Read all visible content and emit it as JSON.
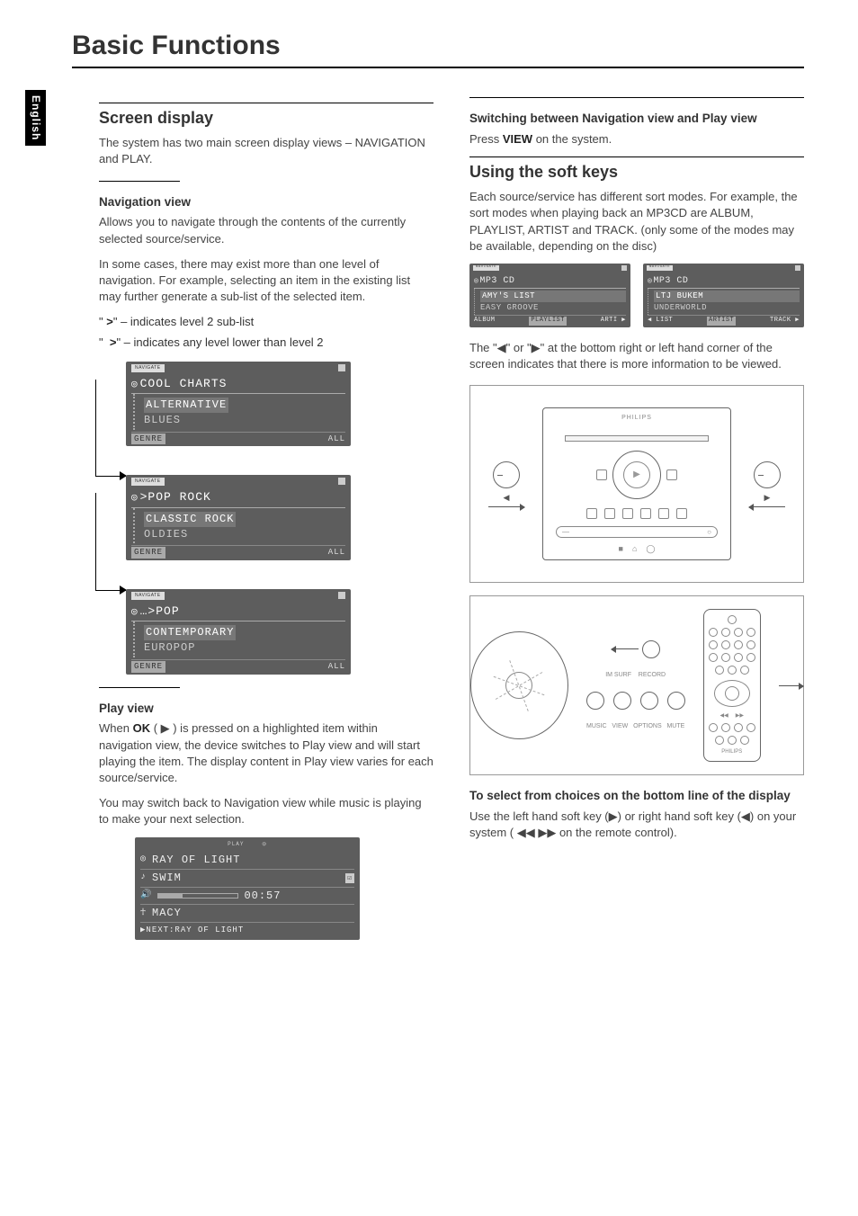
{
  "lang_tab": "English",
  "page_title": "Basic Functions",
  "left": {
    "h2": "Screen display",
    "intro": "The system has two main screen display views – NAVIGATION and PLAY.",
    "nav_view": {
      "heading": "Navigation view",
      "p1": "Allows you to navigate through the contents of the currently selected source/service.",
      "p2": "In some cases, there may exist more than one level of navigation. For example, selecting an item in the existing list may further generate a sub-list of the selected item.",
      "ind1_sym": ">",
      "ind1_txt": " – indicates level 2 sub-list",
      "ind2_sym": ">",
      "ind2_txt": " – indicates any level lower than level 2"
    },
    "lcd1": {
      "tab": "NAVIGATE",
      "title": "COOL CHARTS",
      "rows": [
        "ALTERNATIVE",
        "BLUES"
      ],
      "foot_l": "GENRE",
      "foot_r": "ALL"
    },
    "lcd2": {
      "tab": "NAVIGATE",
      "title": ">POP ROCK",
      "rows": [
        "CLASSIC ROCK",
        "OLDIES"
      ],
      "foot_l": "GENRE",
      "foot_r": "ALL"
    },
    "lcd3": {
      "tab": "NAVIGATE",
      "title": "…>POP",
      "rows": [
        "CONTEMPORARY",
        "EUROPOP"
      ],
      "foot_l": "GENRE",
      "foot_r": "ALL"
    },
    "play_view": {
      "heading": "Play view",
      "p1a": "When ",
      "p1b": "OK",
      "p1c": " ( ▶ ) is pressed on a highlighted item within navigation view, the device switches to Play view and will start playing the item.  The display content in Play view varies for each source/service.",
      "p2": "You may switch back to Navigation view while music is playing to make your next selection."
    },
    "lcd_play": {
      "top_l": "PLAY",
      "title": "RAY OF LIGHT",
      "row2": "SWIM",
      "time": "00:57",
      "row4": "MACY",
      "foot": "NEXT:RAY OF LIGHT"
    }
  },
  "right": {
    "switch": {
      "heading": "Switching between Navigation view and Play view",
      "p_a": "Press ",
      "p_b": "VIEW",
      "p_c": " on the system."
    },
    "soft": {
      "h2": "Using the soft keys",
      "p1": "Each source/service has different sort modes. For example, the sort modes when playing back an MP3CD are ALBUM, PLAYLIST, ARTIST and TRACK. (only some of the modes may be available, depending on the disc)"
    },
    "duoL": {
      "tab": "NAVIGATE",
      "title": "MP3 CD",
      "rows": [
        "AMY'S LIST",
        "EASY GROOVE"
      ],
      "foot": [
        "ALBUM",
        "PLAYLIST",
        "ARTI"
      ]
    },
    "duoR": {
      "tab": "NAVIGATE",
      "title": "MP3 CD",
      "rows": [
        "LTJ BUKEM",
        "UNDERWORLD"
      ],
      "foot": [
        "LIST",
        "ARTIST",
        "TRACK"
      ]
    },
    "arrows_note": "The \"◀\" or \"▶\" at the bottom right or left hand corner of the screen indicates that there is more information to be viewed.",
    "device_label": "PHILIPS",
    "select": {
      "heading": "To select from choices on the bottom line of the display",
      "p": "Use the left hand soft key (▶) or right hand soft key (◀) on your system ( ◀◀   ▶▶ on the remote control)."
    },
    "side_labels": {
      "l": "◀",
      "r": "▶"
    },
    "remote_nav": {
      "prev": "◀◀",
      "next": "▶▶"
    }
  }
}
